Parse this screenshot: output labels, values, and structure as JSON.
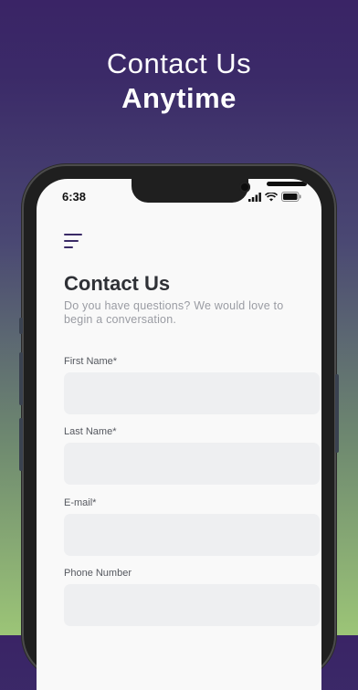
{
  "promo": {
    "line1": "Contact Us",
    "line2": "Anytime"
  },
  "status_bar": {
    "time": "6:38",
    "icons": [
      "signal-icon",
      "wifi-icon",
      "battery-icon"
    ]
  },
  "header": {
    "menu_icon": "hamburger-menu-icon"
  },
  "form": {
    "title": "Contact Us",
    "subtitle": "Do you have questions? We would love to begin a conversation.",
    "fields": [
      {
        "label": "First Name*",
        "value": ""
      },
      {
        "label": "Last Name*",
        "value": ""
      },
      {
        "label": "E-mail*",
        "value": ""
      },
      {
        "label": "Phone Number",
        "value": ""
      }
    ]
  },
  "colors": {
    "bg_top": "#3a2466",
    "bg_bottom": "#9cc577",
    "accent": "#3a2a66",
    "input_bg": "#eeeff1"
  }
}
